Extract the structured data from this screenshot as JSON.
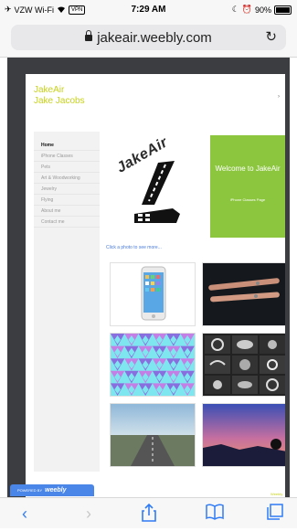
{
  "status_bar": {
    "carrier": "VZW Wi-Fi",
    "vpn_badge": "VPN",
    "time": "7:29 AM",
    "battery": "90%",
    "battery_level": 0.9,
    "icons": [
      "airplane-icon",
      "wifi-icon",
      "moon-icon",
      "alarm-icon",
      "battery-icon"
    ]
  },
  "browser": {
    "url": "jakeair.weebly.com",
    "reload_icon": "reload-icon",
    "lock_icon": "lock-icon"
  },
  "site": {
    "title_line1": "JakeAir",
    "title_line2": "Jake Jacobs",
    "accent_color": "#c7d21a",
    "nav": [
      {
        "label": "Home",
        "active": true
      },
      {
        "label": "iPhone Classes",
        "active": false
      },
      {
        "label": "Pets",
        "active": false
      },
      {
        "label": "Art & Woodworking",
        "active": false
      },
      {
        "label": "Jewelry",
        "active": false
      },
      {
        "label": "Flying",
        "active": false
      },
      {
        "label": "About me",
        "active": false
      },
      {
        "label": "Contact me",
        "active": false
      }
    ],
    "logo_text": "JakeAir",
    "welcome_title": "Welcome to JakeAir",
    "welcome_subtitle": "iPhone Classes Page",
    "welcome_color": "#8cc63f",
    "click_prompt": "Click a photo to see more...",
    "footer_text": "Weebly Site",
    "photos": [
      "iphone-photo",
      "pens-photo",
      "pattern-photo",
      "jewelry-photo",
      "runway-photo",
      "sunset-photo"
    ]
  },
  "weebly_badge": {
    "prefix": "POWERED BY",
    "brand": "weebly"
  },
  "toolbar": {
    "back": "‹",
    "forward": "›",
    "share": "⇧",
    "bookmarks": "📖",
    "tabs": "❐"
  }
}
